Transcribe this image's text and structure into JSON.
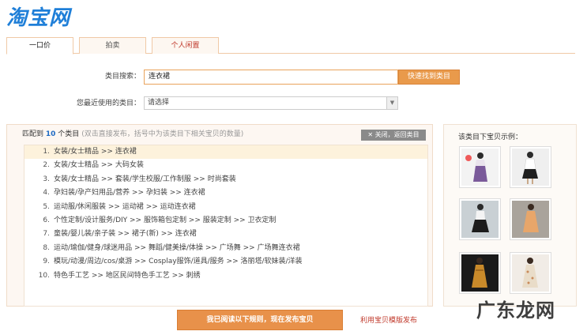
{
  "logo": "淘宝网",
  "tabs": [
    {
      "label": "一口价"
    },
    {
      "label": "拍卖"
    },
    {
      "label": "个人闲置"
    }
  ],
  "search": {
    "label": "类目搜索：",
    "value": "连衣裙",
    "button": "快速找到类目"
  },
  "recent": {
    "label": "您最近使用的类目：",
    "value": "请选择"
  },
  "results": {
    "prefix": "匹配到",
    "count": "10",
    "suffix": "个类目",
    "hint": "(双击直接发布，括号中为该类目下相关宝贝的数量)",
    "close": "关闭，返回类目",
    "items": [
      {
        "num": "1.",
        "path": "女装/女士精品 >> 连衣裙"
      },
      {
        "num": "2.",
        "path": "女装/女士精品 >> 大码女装"
      },
      {
        "num": "3.",
        "path": "女装/女士精品 >> 套装/学生校服/工作制服 >> 时尚套装"
      },
      {
        "num": "4.",
        "path": "孕妇装/孕产妇用品/营养 >> 孕妇装 >> 连衣裙"
      },
      {
        "num": "5.",
        "path": "运动服/休闲服装 >> 运动裙 >> 运动连衣裙"
      },
      {
        "num": "6.",
        "path": "个性定制/设计服务/DIY >> 服饰箱包定制 >> 服装定制 >> 卫衣定制"
      },
      {
        "num": "7.",
        "path": "童装/婴儿装/亲子装 >> 裙子(新) >> 连衣裙"
      },
      {
        "num": "8.",
        "path": "运动/瑜伽/健身/球迷用品 >> 舞蹈/健美操/体操 >> 广场舞 >> 广场舞连衣裙"
      },
      {
        "num": "9.",
        "path": "模玩/动漫/周边/cos/桌游 >> Cosplay服饰/道具/服务 >> 洛丽塔/软妹装/洋装"
      },
      {
        "num": "10.",
        "path": "特色手工艺 >> 地区民间特色手工艺 >> 刺绣"
      }
    ]
  },
  "examples": {
    "title": "该类目下宝贝示例："
  },
  "actions": {
    "publish": "我已阅读以下规则，现在发布宝贝",
    "template": "利用宝贝模版发布"
  },
  "watermark": "广东龙网"
}
